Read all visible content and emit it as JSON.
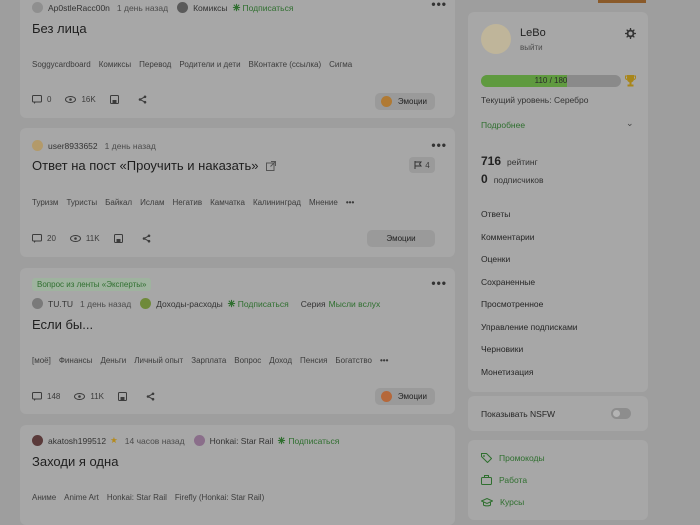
{
  "posts": [
    {
      "author": "Ap0stleRacc00n",
      "time": "1 день назад",
      "community": "Комиксы",
      "subscribe": "Подписаться",
      "title": "Без лица",
      "tags": [
        "Soggycardboard",
        "Комиксы",
        "Перевод",
        "Родители и дети",
        "ВКонтакте (ссылка)",
        "Сигма"
      ],
      "comments": "0",
      "views": "16K",
      "emotions": "Эмоции"
    },
    {
      "author": "user8933652",
      "time": "1 день назад",
      "title": "Ответ на пост «Проучить и наказать»",
      "reposts": "4",
      "tags": [
        "Туризм",
        "Туристы",
        "Байкал",
        "Ислам",
        "Негатив",
        "Камчатка",
        "Калининград",
        "Мнение"
      ],
      "comments": "20",
      "views": "11K",
      "emotions": "Эмоции"
    },
    {
      "question_label": "Вопрос из ленты «Эксперты»",
      "author": "TU.TU",
      "time": "1 день назад",
      "community": "Доходы-расходы",
      "subscribe": "Подписаться",
      "series_label": "Серия",
      "series": "Мысли вслух",
      "title": "Если бы...",
      "tags": [
        "[моё]",
        "Финансы",
        "Деньги",
        "Личный опыт",
        "Зарплата",
        "Вопрос",
        "Доход",
        "Пенсия",
        "Богатство"
      ],
      "comments": "148",
      "views": "11K",
      "emotions": "Эмоции"
    },
    {
      "author": "akatosh199512",
      "time": "14 часов назад",
      "community": "Honkai: Star Rail",
      "subscribe": "Подписаться",
      "title": "Заходи я одна",
      "tags": [
        "Аниме",
        "Anime Art",
        "Honkai: Star Rail",
        "Firefly (Honkai: Star Rail)"
      ]
    }
  ],
  "profile": {
    "username": "LeBo",
    "logout": "выйти",
    "progress_text": "110 / 180",
    "progress_fraction": 0.611,
    "level": "Текущий уровень: Серебро",
    "more": "Подробнее",
    "rating_value": "716",
    "rating_label": "рейтинг",
    "subs_value": "0",
    "subs_label": "подписчиков"
  },
  "menu": [
    "Ответы",
    "Комментарии",
    "Оценки",
    "Сохраненные",
    "Просмотренное",
    "Управление подписками",
    "Черновики",
    "Монетизация"
  ],
  "nsfw_label": "Показывать NSFW",
  "links": [
    "Промокоды",
    "Работа",
    "Курсы"
  ]
}
